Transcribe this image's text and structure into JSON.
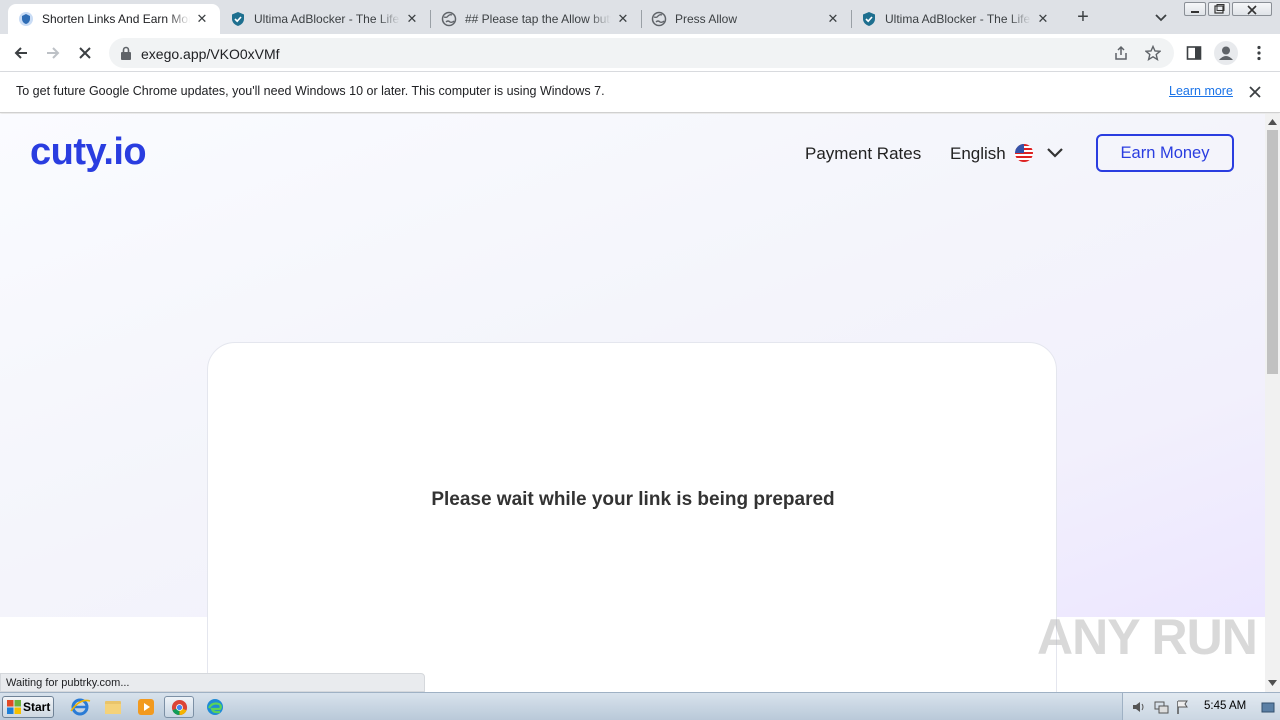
{
  "tabs": [
    {
      "title": "Shorten Links And Earn Money",
      "active": true,
      "icon": "cuty-shield-icon"
    },
    {
      "title": "Ultima AdBlocker - The Life with",
      "active": false,
      "icon": "shield-check-icon"
    },
    {
      "title": "## Please tap the Allow button",
      "active": false,
      "icon": "globe-icon"
    },
    {
      "title": "Press Allow",
      "active": false,
      "icon": "globe-icon"
    },
    {
      "title": "Ultima AdBlocker - The Life with",
      "active": false,
      "icon": "shield-check-icon"
    }
  ],
  "address_bar": {
    "url": "exego.app/VKO0xVMf"
  },
  "infobar": {
    "message": "To get future Google Chrome updates, you'll need Windows 10 or later. This computer is using Windows 7.",
    "learn_more": "Learn more"
  },
  "site": {
    "logo": "cuty.io",
    "nav_payment_rates": "Payment Rates",
    "nav_language": "English",
    "earn_money_button": "Earn Money",
    "wait_message": "Please wait while your link is being prepared"
  },
  "status_bar": "Waiting for pubtrky.com...",
  "watermark": "ANY RUN",
  "taskbar": {
    "start_label": "Start",
    "clock": "5:45 AM"
  },
  "colors": {
    "brand": "#2a3de0",
    "tab_strip": "#dee1e6",
    "link": "#1a73e8"
  }
}
